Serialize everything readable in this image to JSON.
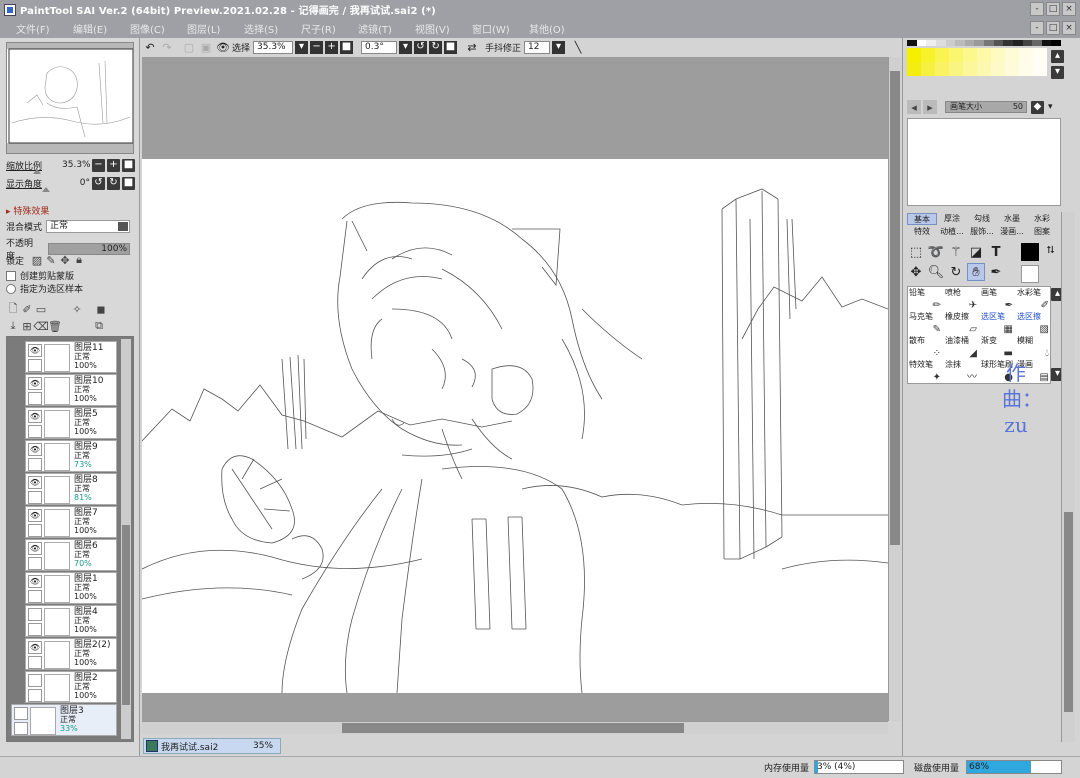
{
  "window": {
    "title": "PaintTool SAI Ver.2 (64bit) Preview.2021.02.28 - 记得画完 / 我再试试.sai2 (*)",
    "controls": [
      "-",
      "□",
      "×"
    ]
  },
  "menu": {
    "items": [
      "文件(F)",
      "编辑(E)",
      "图像(C)",
      "图层(L)",
      "选择(S)",
      "尺子(R)",
      "滤镜(T)",
      "视图(V)",
      "窗口(W)",
      "其他(O)"
    ]
  },
  "toolbar": {
    "select_label": "选择",
    "zoom_value": "35.3%",
    "angle_value": "0.3°",
    "stabilizer_label": "手抖修正",
    "stabilizer_value": "12"
  },
  "navigator": {
    "zoom_label": "缩放比例",
    "zoom_value": "35.3%",
    "angle_label": "显示角度",
    "angle_value": "0°"
  },
  "layer_props": {
    "section_title": "特殊效果",
    "blend_label": "混合模式",
    "blend_value": "正常",
    "opacity_label": "不透明度",
    "opacity_value": "100%",
    "opacity_fraction": 1.0,
    "lock_label": "锁定",
    "clip_label": "创建剪贴蒙版",
    "ref_label": "指定为选区样本"
  },
  "layers": [
    {
      "name": "图层11",
      "mode": "正常",
      "opacity": "100%",
      "visible": true,
      "teal": false
    },
    {
      "name": "图层10",
      "mode": "正常",
      "opacity": "100%",
      "visible": true,
      "teal": false
    },
    {
      "name": "图层5",
      "mode": "正常",
      "opacity": "100%",
      "visible": true,
      "teal": false
    },
    {
      "name": "图层9",
      "mode": "正常",
      "opacity": "73%",
      "visible": true,
      "teal": true
    },
    {
      "name": "图层8",
      "mode": "正常",
      "opacity": "81%",
      "visible": true,
      "teal": true
    },
    {
      "name": "图层7",
      "mode": "正常",
      "opacity": "100%",
      "visible": true,
      "teal": false
    },
    {
      "name": "图层6",
      "mode": "正常",
      "opacity": "70%",
      "visible": true,
      "teal": true
    },
    {
      "name": "图层1",
      "mode": "正常",
      "opacity": "100%",
      "visible": true,
      "teal": false
    },
    {
      "name": "图层4",
      "mode": "正常",
      "opacity": "100%",
      "visible": false,
      "teal": false
    },
    {
      "name": "图层2(2)",
      "mode": "正常",
      "opacity": "100%",
      "visible": true,
      "teal": false
    },
    {
      "name": "图层2",
      "mode": "正常",
      "opacity": "100%",
      "visible": false,
      "teal": false
    },
    {
      "name": "图层3",
      "mode": "正常",
      "opacity": "33%",
      "visible": false,
      "teal": true,
      "selected": true
    }
  ],
  "right_panel": {
    "brush_size_label": "画笔大小",
    "brush_size_value": "50",
    "tool_tabs_row1": [
      "基本",
      "厚涂",
      "勾线",
      "水墨",
      "水彩"
    ],
    "tool_tabs_row2": [
      "特效",
      "动植...",
      "服饰...",
      "漫画...",
      "图案"
    ],
    "brushes": [
      {
        "name": "铅笔",
        "blue": false
      },
      {
        "name": "喷枪",
        "blue": false
      },
      {
        "name": "画笔",
        "blue": false
      },
      {
        "name": "水彩笔",
        "blue": false
      },
      {
        "name": "马克笔",
        "blue": false
      },
      {
        "name": "橡皮擦",
        "blue": false
      },
      {
        "name": "选区笔",
        "blue": true
      },
      {
        "name": "选区擦",
        "blue": true
      },
      {
        "name": "散布",
        "blue": false
      },
      {
        "name": "油漆桶",
        "blue": false
      },
      {
        "name": "渐变",
        "blue": false
      },
      {
        "name": "模糊",
        "blue": false
      },
      {
        "name": "特效笔",
        "blue": false
      },
      {
        "name": "涂抹",
        "blue": false
      },
      {
        "name": "球形笔刷",
        "blue": false
      },
      {
        "name": "漫画",
        "blue": false
      }
    ],
    "watermark": "作曲：zu"
  },
  "document_tab": {
    "name": "我再试试.sai2",
    "zoom": "35%"
  },
  "status": {
    "memory_label": "内存使用量",
    "memory_value": "3% (4%)",
    "memory_fraction": 0.03,
    "disk_label": "磁盘使用量",
    "disk_value": "68%",
    "disk_fraction": 0.68
  },
  "colors": {
    "chrome": "#9ea0a6",
    "panel": "#d4d4d4",
    "canvas_bg": "#9d9d9d",
    "accent_blue": "#2fa8e0",
    "teal_text": "#1a9a8a",
    "watermark": "#5a74d8"
  }
}
